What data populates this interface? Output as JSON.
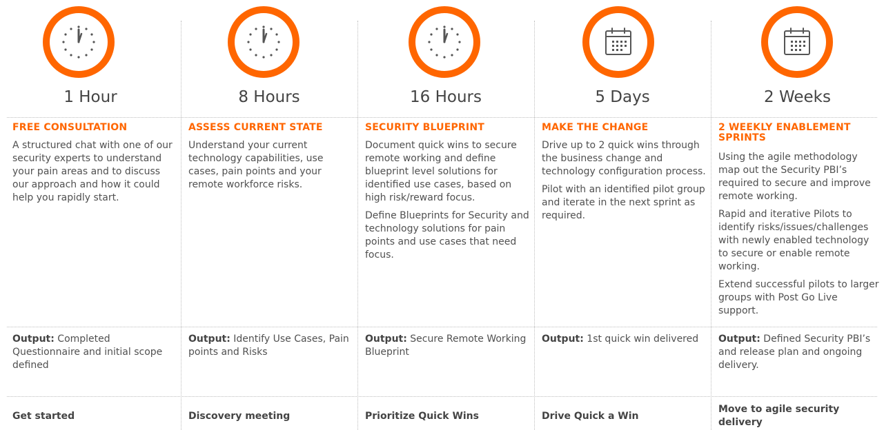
{
  "accent_color": "#ff6600",
  "columns": [
    {
      "icon": "clock-icon",
      "duration": "1 Hour",
      "heading": "FREE CONSULTATION",
      "description": [
        "A structured chat with one of our security experts to understand your pain areas and to discuss our approach and how it could help you rapidly start."
      ],
      "output_label": "Output:",
      "output_text": " Completed Questionnaire and initial scope defined",
      "action": "Get started"
    },
    {
      "icon": "clock-icon",
      "duration": "8 Hours",
      "heading": "ASSESS CURRENT STATE",
      "description": [
        "Understand your current technology capabilities, use cases, pain points and your remote workforce risks."
      ],
      "output_label": "Output:",
      "output_text": " Identify Use Cases, Pain points and Risks",
      "action": "Discovery meeting"
    },
    {
      "icon": "clock-icon",
      "duration": "16 Hours",
      "heading": "SECURITY BLUEPRINT",
      "description": [
        "Document quick wins to secure remote working and define blueprint level solutions for identified use cases, based on high risk/reward focus.",
        "Define Blueprints for Security and technology solutions for pain points and use cases that need focus."
      ],
      "output_label": "Output:",
      "output_text": " Secure Remote Working Blueprint",
      "action": "Prioritize Quick Wins"
    },
    {
      "icon": "calendar-icon",
      "duration": "5 Days",
      "heading": "MAKE THE CHANGE",
      "description": [
        "Drive up to 2 quick wins through the business change and technology configuration process.",
        "Pilot with an identified pilot group and iterate in the next sprint as required."
      ],
      "output_label": "Output:",
      "output_text": " 1st quick win delivered",
      "action": "Drive Quick a Win"
    },
    {
      "icon": "calendar-icon",
      "duration": "2 Weeks",
      "heading": "2 WEEKLY ENABLEMENT SPRINTS",
      "description": [
        "Using the agile methodology map out the Security PBI’s required to secure and improve remote working.",
        "Rapid and iterative Pilots to identify risks/issues/challenges with newly enabled technology to secure or enable remote working.",
        "Extend successful pilots to larger groups with Post Go Live support."
      ],
      "output_label": "Output:",
      "output_text": " Defined Security PBI’s and release plan and ongoing delivery.",
      "action": "Move to agile security delivery"
    }
  ]
}
